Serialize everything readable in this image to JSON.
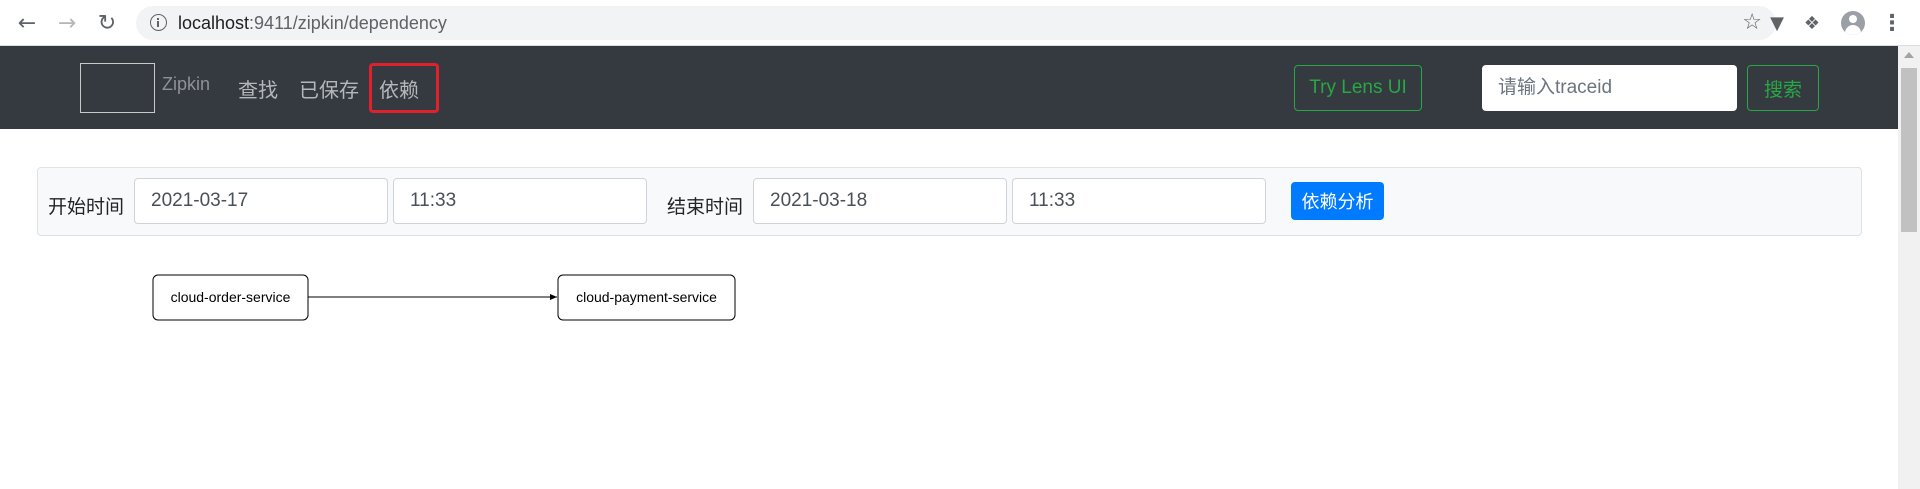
{
  "browser": {
    "url_host": "localhost",
    "url_path": ":9411/zipkin/dependency"
  },
  "navbar": {
    "brand": "Zipkin",
    "links": [
      "查找",
      "已保存",
      "依赖"
    ],
    "active_link": "依赖",
    "lens_button": "Try Lens UI",
    "traceid_placeholder": "请输入traceid",
    "search_button": "搜索"
  },
  "filter": {
    "start_label": "开始时间",
    "start_date": "2021-03-17",
    "start_time": "11:33",
    "end_label": "结束时间",
    "end_date": "2021-03-18",
    "end_time": "11:33",
    "analyze_button": "依赖分析"
  },
  "graph": {
    "nodes": [
      "cloud-order-service",
      "cloud-payment-service"
    ],
    "edges": [
      {
        "from": "cloud-order-service",
        "to": "cloud-payment-service"
      }
    ]
  },
  "colors": {
    "navbar_bg": "#343a40",
    "success": "#28a745",
    "primary": "#007bff",
    "highlight": "#e0202a"
  }
}
